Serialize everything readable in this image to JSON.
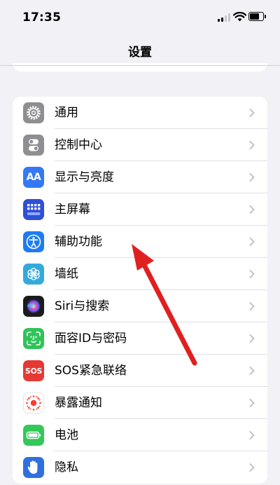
{
  "status_bar": {
    "time": "17:35",
    "signal_icon": "cellular-signal-icon",
    "wifi_icon": "wifi-icon",
    "battery_icon": "battery-icon",
    "battery_level": 0.8
  },
  "nav": {
    "title": "设置"
  },
  "settings": [
    {
      "label": "通用",
      "icon": "gear-icon",
      "icon_bg": "#8e8e93"
    },
    {
      "label": "控制中心",
      "icon": "toggle-icon",
      "icon_bg": "#8e8e93"
    },
    {
      "label": "显示与亮度",
      "icon": "text-size-icon",
      "icon_bg": "#3478f6"
    },
    {
      "label": "主屏幕",
      "icon": "home-grid-icon",
      "icon_bg": "#2f4fd8"
    },
    {
      "label": "辅助功能",
      "icon": "accessibility-icon",
      "icon_bg": "#1e7cf2"
    },
    {
      "label": "墙纸",
      "icon": "wallpaper-icon",
      "icon_bg": "#34aadc"
    },
    {
      "label": "Siri与搜索",
      "icon": "siri-icon",
      "icon_bg": "#1c1c1e"
    },
    {
      "label": "面容ID与密码",
      "icon": "face-id-icon",
      "icon_bg": "#30c35a"
    },
    {
      "label": "SOS紧急联络",
      "icon": "sos-icon",
      "icon_bg": "#e53935"
    },
    {
      "label": "暴露通知",
      "icon": "exposure-icon",
      "icon_bg": "#ffffff"
    },
    {
      "label": "电池",
      "icon": "battery-setting-icon",
      "icon_bg": "#34c759"
    },
    {
      "label": "隐私",
      "icon": "privacy-hand-icon",
      "icon_bg": "#2f6fe0"
    }
  ],
  "sos_text": "SOS",
  "text_size_glyph": "AA",
  "annotation": {
    "color": "#e02020"
  }
}
